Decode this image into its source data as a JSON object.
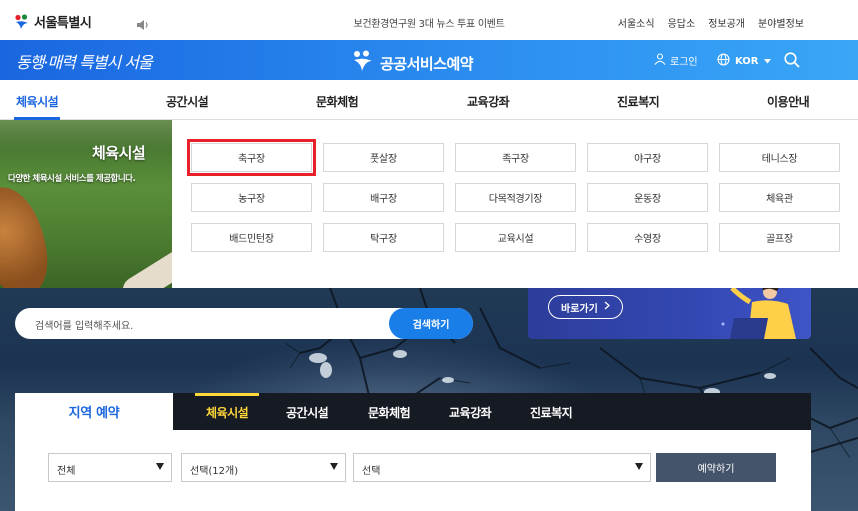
{
  "topbar": {
    "logo_text": "서울특별시",
    "ticker": "보건환경연구원 3대 뉴스 투표 이벤트",
    "utils": [
      "서울소식",
      "응답소",
      "정보공개",
      "분야별정보"
    ]
  },
  "banner": {
    "slogan": "동행·매력 특별시 서울",
    "service_title": "공공서비스예약",
    "login": "로그인",
    "lang": "KOR",
    "colors": {
      "banner_start": "#1a66e0",
      "banner_end": "#39a6f6"
    }
  },
  "mainnav": {
    "items": [
      "체육시설",
      "공간시설",
      "문화체험",
      "교육강좌",
      "진료복지",
      "이용안내"
    ],
    "active": "체육시설"
  },
  "dropdown": {
    "promo_title": "체육시설",
    "promo_desc": "다양한 체육시설 서비스를 제공합니다.",
    "facilities": [
      "축구장",
      "풋살장",
      "족구장",
      "야구장",
      "테니스장",
      "농구장",
      "배구장",
      "다목적경기장",
      "운동장",
      "체육관",
      "배드민턴장",
      "탁구장",
      "교육시설",
      "수영장",
      "골프장"
    ],
    "selected": "축구장",
    "highlight_color": "#e8202a"
  },
  "hero": {
    "search_placeholder": "검색어를 입력해주세요.",
    "search_button": "검색하기",
    "shortcut_button": "바로가기"
  },
  "widget": {
    "region_tab": "지역 예약",
    "tabs": [
      "체육시설",
      "공간시설",
      "문화체험",
      "교육강좌",
      "진료복지"
    ],
    "active_tab": "체육시설",
    "select_region": "전체",
    "select_category": "선택(12개)",
    "select_facility": "선택",
    "reserve_button": "예약하기",
    "accent_color": "#ffd83a"
  }
}
